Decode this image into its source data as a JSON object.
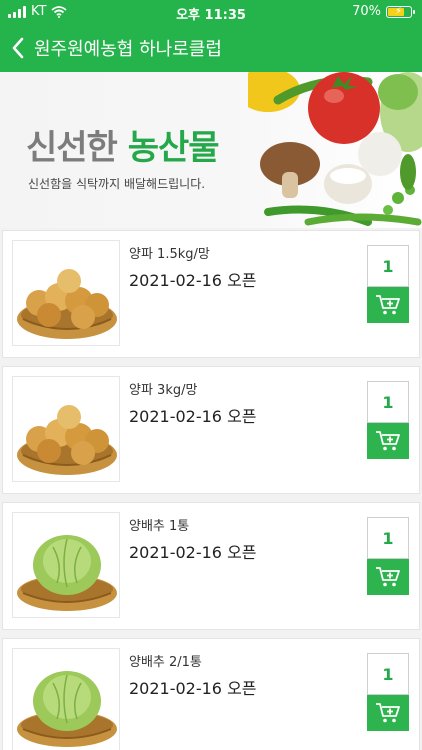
{
  "status_bar": {
    "carrier": "KT",
    "time": "오후 11:35",
    "battery_percent": "70%"
  },
  "header": {
    "title": "원주원예농협 하나로클럽",
    "back_icon": "chevron-left-icon"
  },
  "banner": {
    "title_part1": "신선한",
    "title_part2": "농산물",
    "subtitle": "신선함을 식탁까지 배달해드립니다."
  },
  "colors": {
    "brand_green": "#25b34b",
    "banner_green_text": "#25a84a",
    "battery_fill": "#f5d21a"
  },
  "products": [
    {
      "name": "양파 1.5kg/망",
      "date": "2021-02-16 오픈",
      "quantity": "1",
      "image": "onion-basket",
      "cart_icon": "cart-add-icon"
    },
    {
      "name": "양파 3kg/망",
      "date": "2021-02-16 오픈",
      "quantity": "1",
      "image": "onion-basket",
      "cart_icon": "cart-add-icon"
    },
    {
      "name": "양배추 1통",
      "date": "2021-02-16 오픈",
      "quantity": "1",
      "image": "cabbage-basket",
      "cart_icon": "cart-add-icon"
    },
    {
      "name": "양배추 2/1통",
      "date": "2021-02-16 오픈",
      "quantity": "1",
      "image": "cabbage-basket",
      "cart_icon": "cart-add-icon"
    }
  ]
}
